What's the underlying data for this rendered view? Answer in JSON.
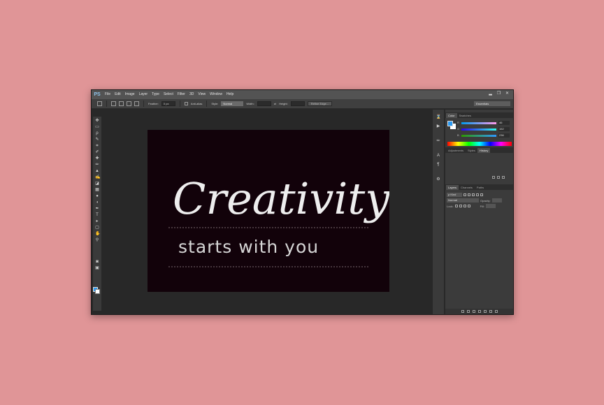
{
  "app": {
    "logo": "PS"
  },
  "menu": [
    "File",
    "Edit",
    "Image",
    "Layer",
    "Type",
    "Select",
    "Filter",
    "3D",
    "View",
    "Window",
    "Help"
  ],
  "window_controls": {
    "minimize": "▂",
    "restore": "❐",
    "close": "✕"
  },
  "options": {
    "feather_label": "Feather:",
    "feather_value": "0 px",
    "antialias_label": "Anti-alias",
    "style_label": "Style:",
    "style_value": "Normal",
    "width_label": "Width:",
    "height_label": "Height:",
    "refine_edge": "Refine Edge...",
    "workspace": "Essentials"
  },
  "canvas": {
    "background": "#12020a",
    "headline": "Creativity",
    "tagline": "starts with you"
  },
  "color_panel": {
    "tabs": [
      "Color",
      "Swatches"
    ],
    "channels": [
      {
        "letter": "R",
        "value": "46"
      },
      {
        "letter": "G",
        "value": "152"
      },
      {
        "letter": "B",
        "value": "236"
      }
    ],
    "foreground": "#2b9af3",
    "background": "#ffffff"
  },
  "adjust_panel": {
    "tabs": [
      "Adjustments",
      "Styles",
      "History"
    ]
  },
  "layers_panel": {
    "tabs": [
      "Layers",
      "Channels",
      "Paths"
    ],
    "kind": "ρ Kind",
    "blend_mode": "Normal",
    "opacity_label": "Opacity:",
    "lock_label": "Lock:",
    "fill_label": "Fill:"
  }
}
